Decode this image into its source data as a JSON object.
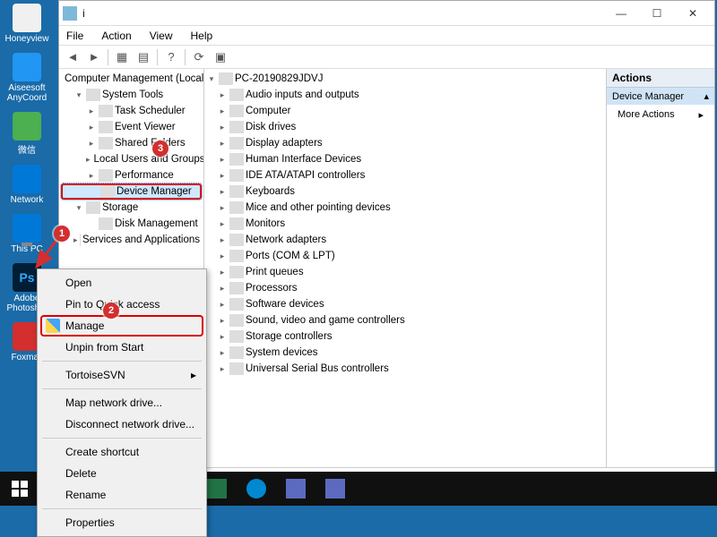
{
  "desktop": {
    "icons": [
      {
        "label": "Honeyview",
        "cls": "ico-honey"
      },
      {
        "label": "Aiseesoft AnyCoord",
        "cls": "ico-aisee"
      },
      {
        "label": "微信",
        "cls": "ico-wechat"
      },
      {
        "label": "Network",
        "cls": "ico-network"
      },
      {
        "label": "This PC",
        "cls": "ico-thispc"
      },
      {
        "label": "Adobe Photosh...",
        "cls": "ico-ps",
        "txt": "Ps"
      },
      {
        "label": "Foxmail",
        "cls": "ico-foxm"
      }
    ]
  },
  "window": {
    "title": "i",
    "menu": [
      "File",
      "Action",
      "View",
      "Help"
    ],
    "win_buttons": {
      "min": "—",
      "max": "☐",
      "close": "✕"
    },
    "left_tree": [
      {
        "lvl": 0,
        "exp": "",
        "label": "Computer Management (Local)",
        "ic": "ic-blue"
      },
      {
        "lvl": 1,
        "exp": "▾",
        "label": "System Tools",
        "ic": "ic-gray"
      },
      {
        "lvl": 2,
        "exp": "▸",
        "label": "Task Scheduler",
        "ic": "ic-blue"
      },
      {
        "lvl": 2,
        "exp": "▸",
        "label": "Event Viewer",
        "ic": "ic-teal"
      },
      {
        "lvl": 2,
        "exp": "▸",
        "label": "Shared Folders",
        "ic": "ic-yellow"
      },
      {
        "lvl": 2,
        "exp": "▸",
        "label": "Local Users and Groups",
        "ic": "ic-blue"
      },
      {
        "lvl": 2,
        "exp": "▸",
        "label": "Performance",
        "ic": "ic-green"
      },
      {
        "lvl": 2,
        "exp": "",
        "label": "Device Manager",
        "ic": "ic-blue",
        "hl": true
      },
      {
        "lvl": 1,
        "exp": "▾",
        "label": "Storage",
        "ic": "ic-gray"
      },
      {
        "lvl": 2,
        "exp": "",
        "label": "Disk Management",
        "ic": "ic-gray"
      },
      {
        "lvl": 1,
        "exp": "▸",
        "label": "Services and Applications",
        "ic": "ic-gray"
      }
    ],
    "pc_root": "PC-20190829JDVJ",
    "devices": [
      "Audio inputs and outputs",
      "Computer",
      "Disk drives",
      "Display adapters",
      "Human Interface Devices",
      "IDE ATA/ATAPI controllers",
      "Keyboards",
      "Mice and other pointing devices",
      "Monitors",
      "Network adapters",
      "Ports (COM & LPT)",
      "Print queues",
      "Processors",
      "Software devices",
      "Sound, video and game controllers",
      "Storage controllers",
      "System devices",
      "Universal Serial Bus controllers"
    ],
    "actions": {
      "header": "Actions",
      "selected": "Device Manager",
      "more": "More Actions"
    }
  },
  "context_menu": {
    "items": [
      {
        "label": "Open"
      },
      {
        "label": "Pin to Quick access"
      },
      {
        "label": "Manage",
        "hl": true,
        "shield": true
      },
      {
        "label": "Unpin from Start"
      },
      {
        "sep": true
      },
      {
        "label": "TortoiseSVN",
        "arrow": "▸"
      },
      {
        "sep": true
      },
      {
        "label": "Map network drive..."
      },
      {
        "label": "Disconnect network drive..."
      },
      {
        "sep": true
      },
      {
        "label": "Create shortcut"
      },
      {
        "label": "Delete"
      },
      {
        "label": "Rename"
      },
      {
        "sep": true
      },
      {
        "label": "Properties"
      }
    ]
  },
  "badges": {
    "b1": "1",
    "b2": "2",
    "b3": "3"
  }
}
